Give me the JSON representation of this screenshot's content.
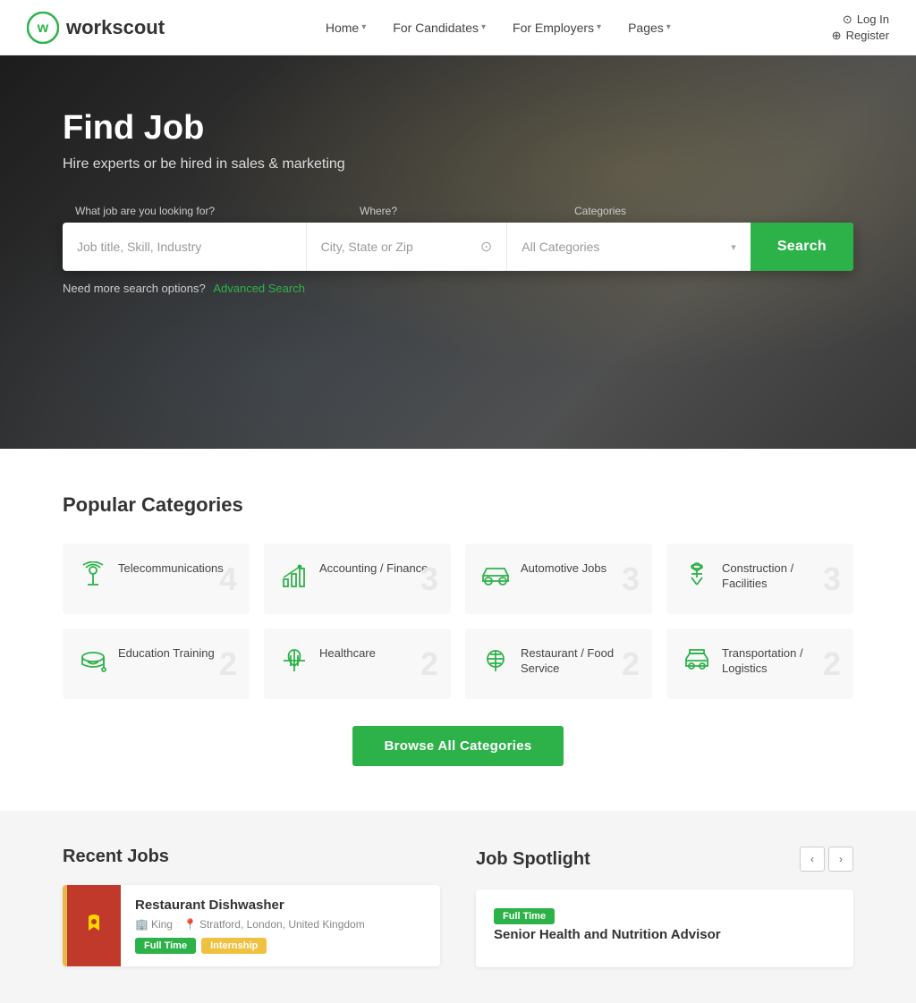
{
  "site": {
    "name": "workscout",
    "logo_text": "workscout"
  },
  "nav": {
    "items": [
      {
        "label": "Home",
        "has_dropdown": true
      },
      {
        "label": "For Candidates",
        "has_dropdown": true
      },
      {
        "label": "For Employers",
        "has_dropdown": true
      },
      {
        "label": "Pages",
        "has_dropdown": true
      }
    ],
    "auth": {
      "login_label": "Log In",
      "register_label": "Register"
    }
  },
  "hero": {
    "title": "Find Job",
    "subtitle": "Hire experts or be hired in sales & marketing",
    "search": {
      "job_placeholder": "Job title, Skill, Industry",
      "location_placeholder": "City, State or Zip",
      "category_placeholder": "All Categories",
      "category_options": [
        "All Categories",
        "Accounting / Finance",
        "Automotive Jobs",
        "Construction / Facilities",
        "Education Training",
        "Healthcare",
        "Restaurant / Food Service",
        "Telecommunications",
        "Transportation / Logistics"
      ],
      "button_label": "Search",
      "labels": {
        "what": "What job are you looking for?",
        "where": "Where?",
        "category": "Categories"
      }
    },
    "advanced_search_text": "Need more search options?",
    "advanced_search_link": "Advanced Search"
  },
  "categories_section": {
    "title": "Popular Categories",
    "items": [
      {
        "name": "Telecommunications",
        "count": "4",
        "icon": "telecom"
      },
      {
        "name": "Accounting / Finance",
        "count": "3",
        "icon": "finance"
      },
      {
        "name": "Automotive Jobs",
        "count": "3",
        "icon": "automotive"
      },
      {
        "name": "Construction / Facilities",
        "count": "3",
        "icon": "construction"
      },
      {
        "name": "Education Training",
        "count": "2",
        "icon": "education"
      },
      {
        "name": "Healthcare",
        "count": "2",
        "icon": "healthcare"
      },
      {
        "name": "Restaurant / Food Service",
        "count": "2",
        "icon": "restaurant"
      },
      {
        "name": "Transportation / Logistics",
        "count": "2",
        "icon": "transport"
      }
    ],
    "browse_button": "Browse All Categories"
  },
  "recent_jobs": {
    "title": "Recent Jobs",
    "jobs": [
      {
        "title": "Restaurant Dishwasher",
        "company": "King",
        "company_logo": "KING",
        "location": "Stratford, London, United Kingdom",
        "badges": [
          "Full Time",
          "Internship"
        ],
        "accent_color": "#e8b84b"
      }
    ]
  },
  "job_spotlight": {
    "title": "Job Spotlight",
    "jobs": [
      {
        "title": "Senior Health and Nutrition Advisor",
        "badge": "Full Time"
      }
    ]
  }
}
